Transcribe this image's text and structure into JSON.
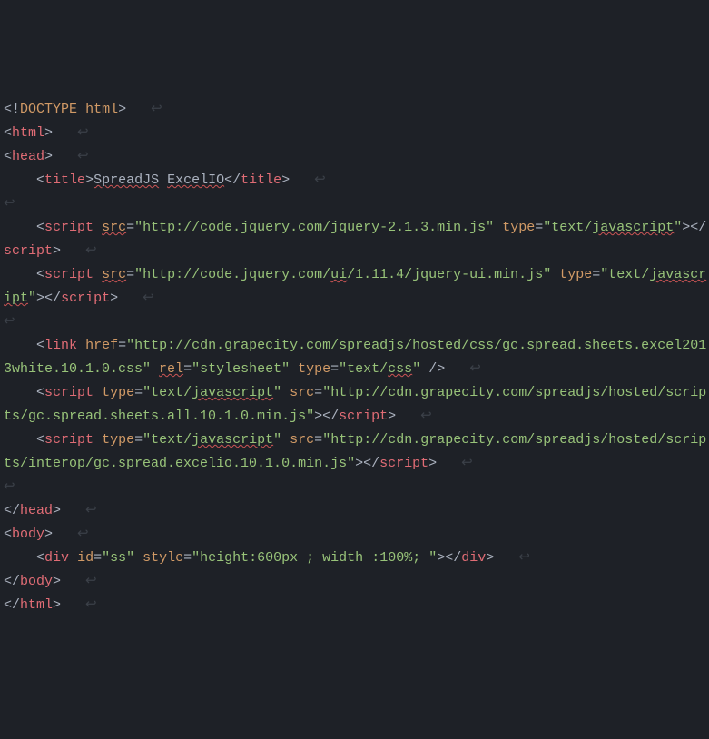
{
  "code": {
    "l1": {
      "t1": "<",
      "t2": "!",
      "t3": "DOCTYPE",
      "t4": " ",
      "t5": "html",
      "t6": ">",
      "ws": "   ↩"
    },
    "l2": {
      "t1": "<",
      "t2": "html",
      "t3": ">",
      "ws": "   ↩"
    },
    "l3": {
      "t1": "<",
      "t2": "head",
      "t3": ">",
      "ws": "   ↩"
    },
    "l4": {
      "indent": "    ",
      "t1": "<",
      "t2": "title",
      "t3": ">",
      "t4": "SpreadJS",
      "t5": " ",
      "t6": "ExcelIO",
      "t7": "</",
      "t8": "title",
      "t9": ">",
      "ws": "   ↩"
    },
    "l5": {
      "ws": "↩"
    },
    "l6": {
      "indent": "    ",
      "t1": "<",
      "t2": "script",
      "t3": " ",
      "t4": "src",
      "t5": "=",
      "t6": "\"http://code.jquery.com/jquery-2.1.3.min.js\"",
      "t7": " "
    },
    "l6b": {
      "t1": "type",
      "t2": "=",
      "t3a": "\"text/",
      "t3b": "javascript",
      "t3c": "\"",
      "t4": ">",
      "t5": "</",
      "t6": "script",
      "t7": ">",
      "ws": "   ↩"
    },
    "l7": {
      "indent": "    ",
      "t1": "<",
      "t2": "script",
      "t3": " ",
      "t4": "src",
      "t5": "=",
      "t6": "\"http://code.jquery.com/",
      "t6b": "ui",
      "t6c": "/1.11.4/jquery-ui.min.js\"",
      "t7": " "
    },
    "l7b": {
      "t1": "type",
      "t2": "=",
      "t3a": "\"text/",
      "t3b": "javascript",
      "t3c": "\"",
      "t4": ">",
      "t5": "</",
      "t6": "script",
      "t7": ">",
      "ws": "   ↩"
    },
    "l8": {
      "ws": "↩"
    },
    "l9": {
      "indent": "    ",
      "t1": "<",
      "t2": "link",
      "t3": " "
    },
    "l9b": {
      "t1": "href",
      "t2": "=",
      "t3": "\"http://cdn.grapecity.com/spreadjs/hosted/css/gc.spread.sheets.excel2"
    },
    "l9c": {
      "t1": "013white.10.1.0.css\"",
      "t2": " ",
      "t3": "rel",
      "t4": "=",
      "t5": "\"stylesheet\"",
      "t6": " ",
      "t7": "type",
      "t8": "=",
      "t9a": "\"text/",
      "t9b": "css",
      "t9c": "\"",
      "t10": " />",
      "ws": "   ↩"
    },
    "l10": {
      "indent": "    ",
      "t1": "<",
      "t2": "script",
      "t3": " ",
      "t4": "type",
      "t5": "=",
      "t6a": "\"text/",
      "t6b": "javascript",
      "t6c": "\"",
      "t7": " "
    },
    "l10b": {
      "t1": "src",
      "t2": "=",
      "t3": "\"http://cdn.grapecity.com/spreadjs/hosted/scripts/gc.spread.sheets.all"
    },
    "l10c": {
      "t1": ".10.1.0.min.js\"",
      "t2": ">",
      "t3": "</",
      "t4": "script",
      "t5": ">",
      "ws": "   ↩"
    },
    "l11": {
      "indent": "    ",
      "t1": "<",
      "t2": "script",
      "t3": " ",
      "t4": "type",
      "t5": "=",
      "t6a": "\"text/",
      "t6b": "javascript",
      "t6c": "\"",
      "t7": " "
    },
    "l11b": {
      "t1": "src",
      "t2": "=",
      "t3": "\"http://cdn.grapecity.com/spreadjs/hosted/scripts/interop/gc.spread.ex"
    },
    "l11c": {
      "t1": "celio.10.1.0.min.js\"",
      "t2": ">",
      "t3": "</",
      "t4": "script",
      "t5": ">",
      "ws": "   ↩"
    },
    "l12": {
      "ws": "↩"
    },
    "l13": {
      "t1": "</",
      "t2": "head",
      "t3": ">",
      "ws": "   ↩"
    },
    "l14": {
      "t1": "<",
      "t2": "body",
      "t3": ">",
      "ws": "   ↩"
    },
    "l15": {
      "indent": "    ",
      "t1": "<",
      "t2": "div",
      "t3": " ",
      "t4": "id",
      "t5": "=",
      "t6": "\"ss\"",
      "t7": " ",
      "t8": "style",
      "t9": "=",
      "t10": "\"height:600px ; width :100%; \"",
      "t11": ">",
      "t12": "</",
      "t13": "div",
      "t14": ">",
      "ws": "   ↩"
    },
    "l16": {
      "t1": "</",
      "t2": "body",
      "t3": ">",
      "ws": "   ↩"
    },
    "l17": {
      "t1": "</",
      "t2": "html",
      "t3": ">",
      "ws": "   ↩"
    }
  }
}
